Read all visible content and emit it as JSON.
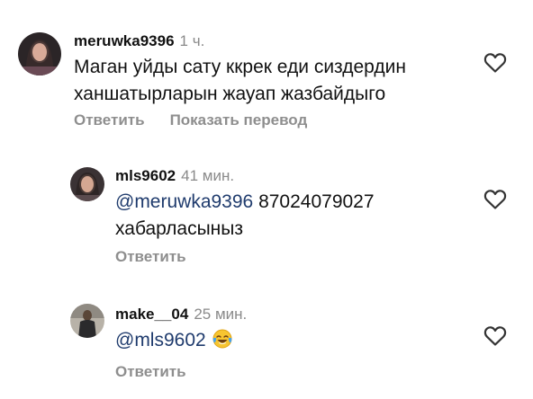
{
  "comments": [
    {
      "username": "meruwka9396",
      "time": "1 ч.",
      "text_lines": [
        "Маган уйды сату ккрек еди сиздердин",
        "ханшатырларын жауап жазбайдыго"
      ],
      "actions": [
        "Ответить",
        "Показать перевод"
      ]
    },
    {
      "username": "mls9602",
      "time": "41 мин.",
      "mention": "@meruwka9396",
      "text_rest": " 87024079027",
      "text_line2": "хабарласыныз",
      "actions": [
        "Ответить"
      ]
    },
    {
      "username": "make__04",
      "time": "25 мин.",
      "mention": "@mls9602",
      "emoji": "face-with-tears-of-joy",
      "actions": [
        "Ответить"
      ]
    }
  ],
  "colors": {
    "mention": "#1f3b6d",
    "secondary_text": "#8e8e8e"
  },
  "icons": [
    "heart-outline-icon",
    "face-with-tears-of-joy-emoji"
  ]
}
